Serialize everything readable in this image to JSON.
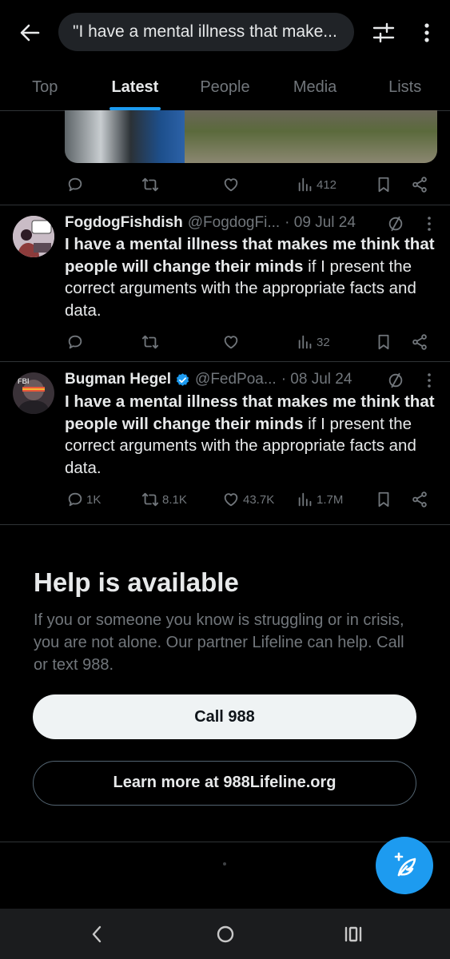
{
  "search": {
    "query": "\"I have a mental illness that make..."
  },
  "tabs": [
    {
      "label": "Top"
    },
    {
      "label": "Latest"
    },
    {
      "label": "People"
    },
    {
      "label": "Media"
    },
    {
      "label": "Lists"
    }
  ],
  "active_tab": "Latest",
  "top_tweet_actions": {
    "views": "412"
  },
  "tweets": [
    {
      "name": "FogdogFishdish",
      "handle": "@FogdogFi...",
      "date": "· 09 Jul 24",
      "verified": false,
      "text_bold": "I have a mental illness that makes me think that people will change their minds",
      "text_rest": " if I present the correct arguments with the appropriate facts and data.",
      "replies": "",
      "retweets": "",
      "likes": "",
      "views": "32"
    },
    {
      "name": "Bugman Hegel",
      "handle": "@FedPoa...",
      "date": "· 08 Jul 24",
      "verified": true,
      "text_bold": "I have a mental illness that makes me think that people will change their minds",
      "text_rest": " if I present the correct arguments with the appropriate facts and data.",
      "replies": "1K",
      "retweets": "8.1K",
      "likes": "43.7K",
      "views": "1.7M",
      "avatar_badge": "FBI"
    }
  ],
  "help": {
    "title": "Help is available",
    "text": "If you or someone you know is struggling or in crisis, you are not alone. Our partner Lifeline can help. Call or text 988.",
    "call_label": "Call 988",
    "learn_label": "Learn more at 988Lifeline.org"
  },
  "colors": {
    "accent": "#1d9bf0",
    "background": "#000000",
    "muted": "#71767b",
    "text": "#e7e9ea"
  },
  "icons": [
    "back-arrow-icon",
    "filter-icon",
    "more-vertical-icon",
    "reply-icon",
    "retweet-icon",
    "like-icon",
    "views-icon",
    "bookmark-icon",
    "share-icon",
    "compose-icon",
    "verified-icon",
    "not-interested-icon"
  ]
}
